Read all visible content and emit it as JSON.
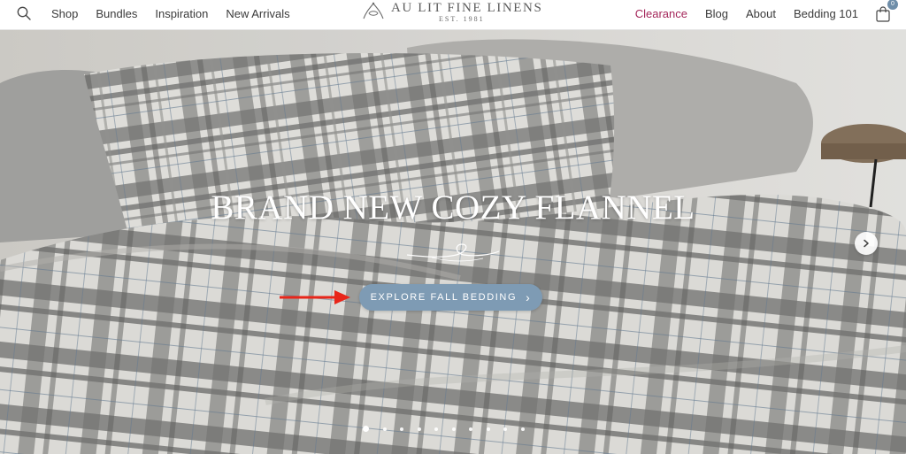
{
  "header": {
    "nav_left": [
      "Shop",
      "Bundles",
      "Inspiration",
      "New Arrivals"
    ],
    "nav_right": [
      "Clearance",
      "Blog",
      "About",
      "Bedding 101"
    ],
    "logo_text": "AU LIT FINE LINENS",
    "logo_est": "EST. 1981",
    "cart_count": "0",
    "clearance_color": "#a4265a"
  },
  "hero": {
    "title": "BRAND NEW COZY FLANNEL",
    "cta_label": "EXPLORE FALL BEDDING",
    "cta_color": "#7e9bb4",
    "slide_count": 10,
    "active_slide": 1,
    "arrow_color": "#e8261a"
  },
  "icons": {
    "search": "search-icon",
    "cart": "shopping-bag-icon",
    "next": "chevron-right-icon",
    "cta_chevron": "chevron-right-icon",
    "annotation": "red-arrow-icon"
  }
}
